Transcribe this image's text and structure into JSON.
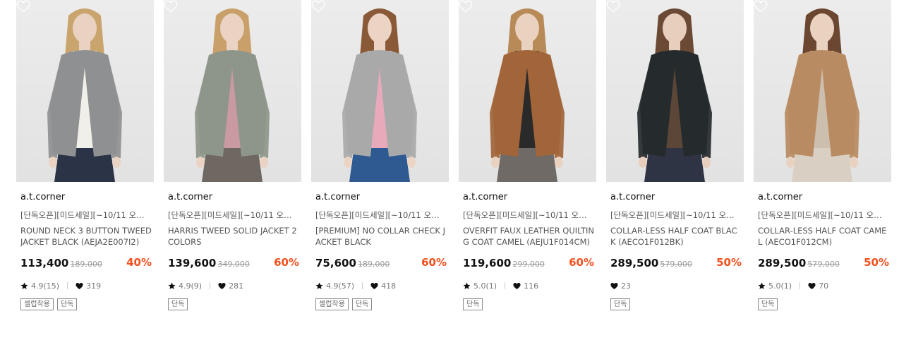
{
  "products": [
    {
      "brand": "a.t.corner",
      "subtitle": "[단독오픈][미드세일][~10/11 오전 10...",
      "name": "ROUND NECK 3 BUTTON TWEED JACKET BLACK (AEJA2E007I2)",
      "price": "113,400",
      "original_price": "189,000",
      "discount": "40%",
      "rating": "4.9(15)",
      "likes": "319",
      "tags": [
        "셀럽착용",
        "단독"
      ],
      "colors": {
        "outfit": "#8f9091",
        "bottom": "#2b3446",
        "inner": "#f1efe9",
        "hair": "#c9a46c",
        "skin": "#e9d2c1"
      }
    },
    {
      "brand": "a.t.corner",
      "subtitle": "[단독오픈][미드세일][~10/11 오전 10...",
      "name": "HARRIS TWEED SOLID JACKET 2 COLORS",
      "price": "139,600",
      "original_price": "349,000",
      "discount": "60%",
      "rating": "4.9(9)",
      "likes": "281",
      "tags": [
        "단독"
      ],
      "colors": {
        "outfit": "#8e968a",
        "bottom": "#6e6762",
        "inner": "#c99aa0",
        "hair": "#c9a06a",
        "skin": "#ead3c3"
      }
    },
    {
      "brand": "a.t.corner",
      "subtitle": "[단독오픈][미드세일][~10/11 오전 10...",
      "name": "[PREMIUM] NO COLLAR CHECK JACKET BLACK",
      "price": "75,600",
      "original_price": "189,000",
      "discount": "60%",
      "rating": "4.9(57)",
      "likes": "418",
      "tags": [
        "셀럽착용",
        "단독"
      ],
      "colors": {
        "outfit": "#a9a9a9",
        "bottom": "#2f5a91",
        "inner": "#e8aabb",
        "hair": "#8a5a38",
        "skin": "#ecd4c4"
      }
    },
    {
      "brand": "a.t.corner",
      "subtitle": "[단독오픈][미드세일][~10/11 오전 10...",
      "name": "OVERFIT FAUX LEATHER QUILTING COAT CAMEL (AEJU1F014CM)",
      "price": "119,600",
      "original_price": "299,000",
      "discount": "60%",
      "rating": "5.0(1)",
      "likes": "116",
      "tags": [
        "단독"
      ],
      "colors": {
        "outfit": "#a2653a",
        "bottom": "#6f6a66",
        "inner": "#2a2a2a",
        "hair": "#b88a58",
        "skin": "#ead2c1"
      }
    },
    {
      "brand": "a.t.corner",
      "subtitle": "[단독오픈][미드세일][~10/11 오전 10...",
      "name": "COLLAR-LESS HALF COAT BLACK (AECO1F012BK)",
      "price": "289,500",
      "original_price": "579,000",
      "discount": "50%",
      "rating": "",
      "likes": "23",
      "tags": [
        "단독"
      ],
      "colors": {
        "outfit": "#252a2c",
        "bottom": "#2e3444",
        "inner": "#5b4638",
        "hair": "#6b4a35",
        "skin": "#e8cfbd"
      }
    },
    {
      "brand": "a.t.corner",
      "subtitle": "[단독오픈][미드세일][~10/11 오전 10...",
      "name": "COLLAR-LESS HALF COAT CAMEL (AECO1F012CM)",
      "price": "289,500",
      "original_price": "579,000",
      "discount": "50%",
      "rating": "5.0(1)",
      "likes": "70",
      "tags": [
        "단독"
      ],
      "colors": {
        "outfit": "#b98b62",
        "bottom": "#d9cfc3",
        "inner": "#ccbfae",
        "hair": "#6b4630",
        "skin": "#ead2c1"
      }
    }
  ]
}
